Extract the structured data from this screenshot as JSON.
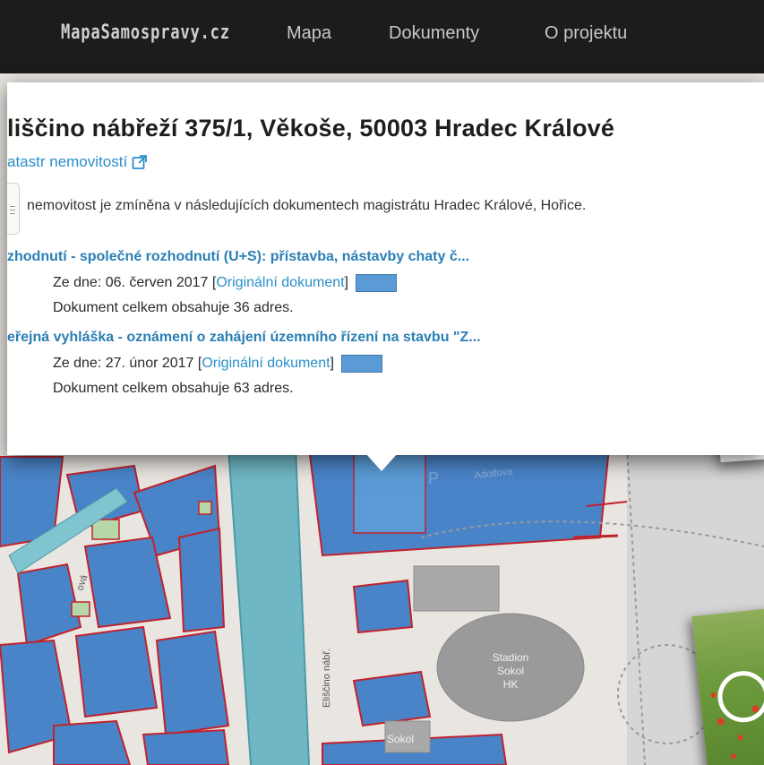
{
  "navbar": {
    "brand": "MapaSamospravy.cz",
    "links": [
      "Mapa",
      "Dokumenty",
      "O projektu"
    ]
  },
  "popup": {
    "address": "liščino nábřeží 375/1, Věkoše, 50003 Hradec Králové",
    "cadastre_link": "atastr nemovitostí",
    "intro": "nemovitost je zmíněna v následujících dokumentech magistrátu Hradec Králové, Hořice.",
    "documents": [
      {
        "title": "zhodnutí - společné rozhodnutí (U+S): přístavba, nástavby chaty č...",
        "date_label": "Ze dne: 06. červen 2017",
        "original_link": "Originální dokument",
        "count_text": "Dokument celkem obsahuje 36 adres."
      },
      {
        "title": "eřejná vyhláška - oznámení o zahájení územního řízení na stavbu \"Z...",
        "date_label": "Ze dne: 27. únor 2017",
        "original_link": "Originální dokument",
        "count_text": "Dokument celkem obsahuje 63 adres."
      }
    ]
  },
  "map": {
    "labels": {
      "stadium": [
        "Stadion",
        "Sokol",
        "HK"
      ],
      "sokol": "Sokol",
      "street_vertical": "Eliščino nábř.",
      "street_left": "ová",
      "area_top": "Adolfova",
      "parking": "P"
    }
  },
  "colors": {
    "navbar": "#1c1c1c",
    "link": "#2a8fc9",
    "doc_title": "#2a7fb5",
    "parcel_fill": "#4a84c8",
    "parcel_border": "#c0222c",
    "water": "#6fb7c4"
  }
}
